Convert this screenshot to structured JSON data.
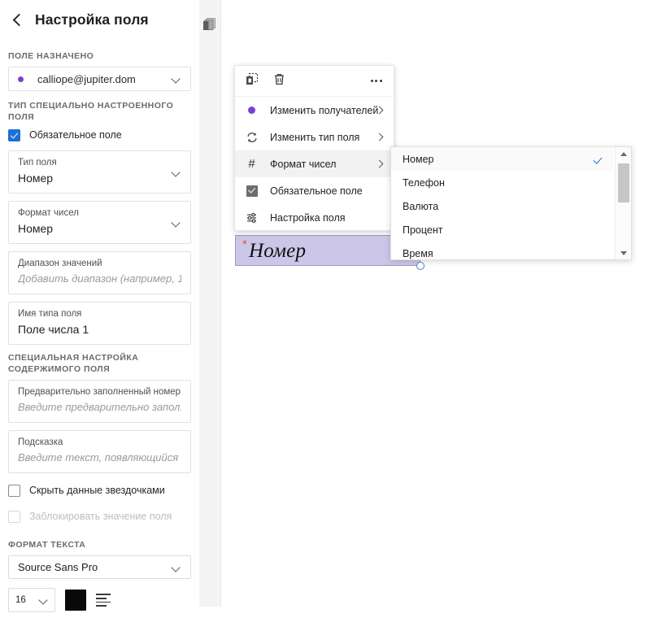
{
  "sidebar": {
    "header": {
      "title": "Настройка поля",
      "back_icon": "chevron-left-icon"
    },
    "assigned_section": {
      "label": "ПОЛЕ НАЗНАЧЕНО",
      "assignee": "calliope@jupiter.dom",
      "dot_color": "#7a3fd4"
    },
    "custom_type_section": {
      "label": "ТИП СПЕЦИАЛЬНО НАСТРОЕННОГО ПОЛЯ",
      "required_checkbox": {
        "label": "Обязательное поле",
        "checked": true,
        "color": "#1d6fd4"
      },
      "fields": [
        {
          "label": "Тип поля",
          "value": "Номер",
          "type": "select"
        },
        {
          "label": "Формат чисел",
          "value": "Номер",
          "type": "select"
        },
        {
          "label": "Диапазон значений",
          "placeholder": "Добавить диапазон (например, 1...",
          "type": "text"
        },
        {
          "label": "Имя типа поля",
          "value": "Поле числа 1",
          "type": "text"
        }
      ]
    },
    "content_section": {
      "label": "СПЕЦИАЛЬНАЯ НАСТРОЙКА СОДЕРЖИМОГО ПОЛЯ",
      "fields": [
        {
          "label": "Предварительно заполненный номер",
          "placeholder": "Введите предварительно запол..."
        },
        {
          "label": "Подсказка",
          "placeholder": "Введите текст, появляющийся ..."
        }
      ],
      "checkboxes": [
        {
          "label": "Скрыть данные звездочками",
          "checked": false,
          "disabled": false
        },
        {
          "label": "Заблокировать значение поля",
          "checked": false,
          "disabled": true
        }
      ]
    },
    "text_format_section": {
      "label": "ФОРМАТ ТЕКСТА",
      "font_family": "Source Sans Pro",
      "font_size": "16",
      "color_swatch": "#0a0a0a",
      "align_icon": "align-left-icon"
    }
  },
  "strip": {
    "doc_icon": "pages-icon"
  },
  "context_menu": {
    "toolbar": {
      "duplicate_icon": "duplicate-icon",
      "delete_icon": "trash-icon",
      "more_icon": "more-options-icon"
    },
    "items": [
      {
        "label": "Изменить получателей",
        "icon": "purple-dot-icon",
        "has_submenu": true,
        "active": false
      },
      {
        "label": "Изменить тип поля",
        "icon": "sync-icon",
        "has_submenu": true,
        "active": false
      },
      {
        "label": "Формат чисел",
        "icon": "hash-icon",
        "has_submenu": true,
        "active": true
      },
      {
        "label": "Обязательное поле",
        "icon": "checkbox-checked-icon",
        "has_submenu": false,
        "active": false
      },
      {
        "label": "Настройка поля",
        "icon": "sliders-icon",
        "has_submenu": false,
        "active": false
      }
    ]
  },
  "submenu": {
    "options": [
      {
        "label": "Номер",
        "selected": true
      },
      {
        "label": "Телефон",
        "selected": false
      },
      {
        "label": "Валюта",
        "selected": false
      },
      {
        "label": "Процент",
        "selected": false
      },
      {
        "label": "Время",
        "selected": false
      }
    ],
    "scrollbar": {
      "up_icon": "scroll-up-icon",
      "down_icon": "scroll-down-icon"
    },
    "check_color": "#1d6fd4"
  },
  "canvas_field": {
    "text": "Номер",
    "required_marker": "*",
    "background": "#ccc6e8",
    "border": "#8b9ec2"
  }
}
